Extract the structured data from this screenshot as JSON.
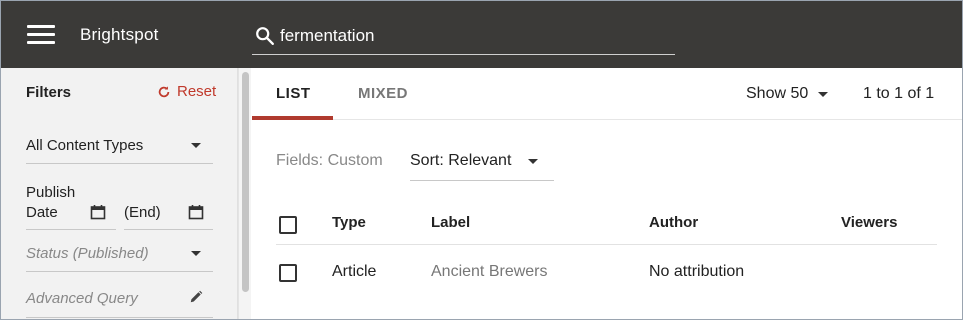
{
  "header": {
    "brand": "Brightspot",
    "search": {
      "value": "fermentation",
      "placeholder": ""
    }
  },
  "sidebar": {
    "title": "Filters",
    "reset_label": "Reset",
    "content_type": "All Content Types",
    "publish_date_line1": "Publish",
    "publish_date_line2": "Date",
    "end_label": "(End)",
    "status": "Status (Published)",
    "advanced_query": "Advanced Query"
  },
  "main": {
    "tabs": [
      {
        "label": "LIST",
        "active": true
      },
      {
        "label": "MIXED",
        "active": false
      }
    ],
    "show_label": "Show 50",
    "pager": "1 to 1 of 1",
    "fields_label": "Fields: Custom",
    "sort_label": "Sort: Relevant",
    "table": {
      "columns": [
        "Type",
        "Label",
        "Author",
        "Viewers"
      ],
      "rows": [
        {
          "type": "Article",
          "label": "Ancient Brewers",
          "author": "No attribution",
          "viewers": ""
        }
      ]
    }
  },
  "colors": {
    "header_bg": "#3b3a38",
    "accent": "#b03a2e",
    "reset": "#c0392b"
  }
}
